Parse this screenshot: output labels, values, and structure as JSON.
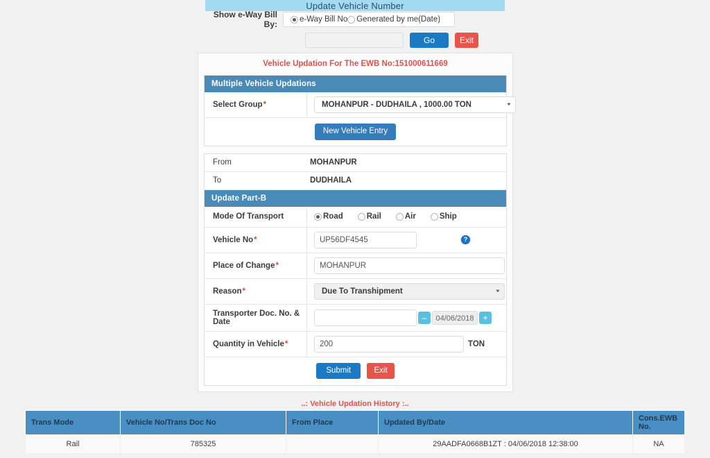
{
  "banner": {
    "title": "Update Vehicle Number"
  },
  "search": {
    "label": "Show e-Way Bill By:",
    "options": [
      {
        "label": "e-Way Bill No",
        "selected": true
      },
      {
        "label": "Generated by me(Date)",
        "selected": false
      }
    ],
    "input_value": "",
    "go_label": "Go",
    "exit_label": "Exit"
  },
  "panel": {
    "ewb_title": "Vehicle Updation For The EWB No:151000611669",
    "multiple_updations": {
      "heading": "Multiple Vehicle Updations",
      "select_group_label": "Select Group",
      "select_group_value": "MOHANPUR - DUDHAILA , 1000.00 TON",
      "new_vehicle_entry_label": "New Vehicle Entry"
    },
    "route": {
      "from_label": "From",
      "from_value": "MOHANPUR",
      "to_label": "To",
      "to_value": "DUDHAILA"
    },
    "part_b": {
      "heading": "Update Part-B",
      "mode_label": "Mode Of Transport",
      "mode_options": [
        {
          "label": "Road",
          "selected": true
        },
        {
          "label": "Rail",
          "selected": false
        },
        {
          "label": "Air",
          "selected": false
        },
        {
          "label": "Ship",
          "selected": false
        }
      ],
      "vehicle_no_label": "Vehicle No",
      "vehicle_no_value": "UP56DF4545",
      "help_icon": "help-icon",
      "place_of_change_label": "Place of Change",
      "place_of_change_value": "MOHANPUR",
      "reason_label": "Reason",
      "reason_value": "Due To Transhipment",
      "transporter_doc_label": "Transporter Doc. No. & Date",
      "transporter_doc_value": "",
      "date_minus_label": "–",
      "date_value": "04/06/2018",
      "date_plus_label": "+",
      "quantity_label": "Quantity in Vehicle",
      "quantity_value": "200",
      "quantity_unit": "TON",
      "submit_label": "Submit",
      "exit_label": "Exit"
    }
  },
  "history": {
    "title": "..: Vehicle Updation History :..",
    "columns": [
      "Trans Mode",
      "Vehicle No/Trans Doc No",
      "From Place",
      "Updated By/Date",
      "Cons.EWB No."
    ],
    "rows": [
      {
        "trans_mode": "Rail",
        "vehicle_no": "785325",
        "from_place": "",
        "updated_by_date": "29AADFA0668B1ZT : 04/06/2018 12:38:00",
        "cons_ewb_no": "NA"
      }
    ]
  },
  "colors": {
    "banner_bg": "#a3dbf2",
    "panel_head_bg": "#4a8ab8",
    "primary_btn": "#1a7bc4",
    "danger_btn": "#e8544a",
    "info_btn": "#5bc0de",
    "required_star": "#e24b3b",
    "title_red": "#d9534f",
    "table_head_bg": "#4a8fc4",
    "page_bg": "#f1f1f1"
  }
}
